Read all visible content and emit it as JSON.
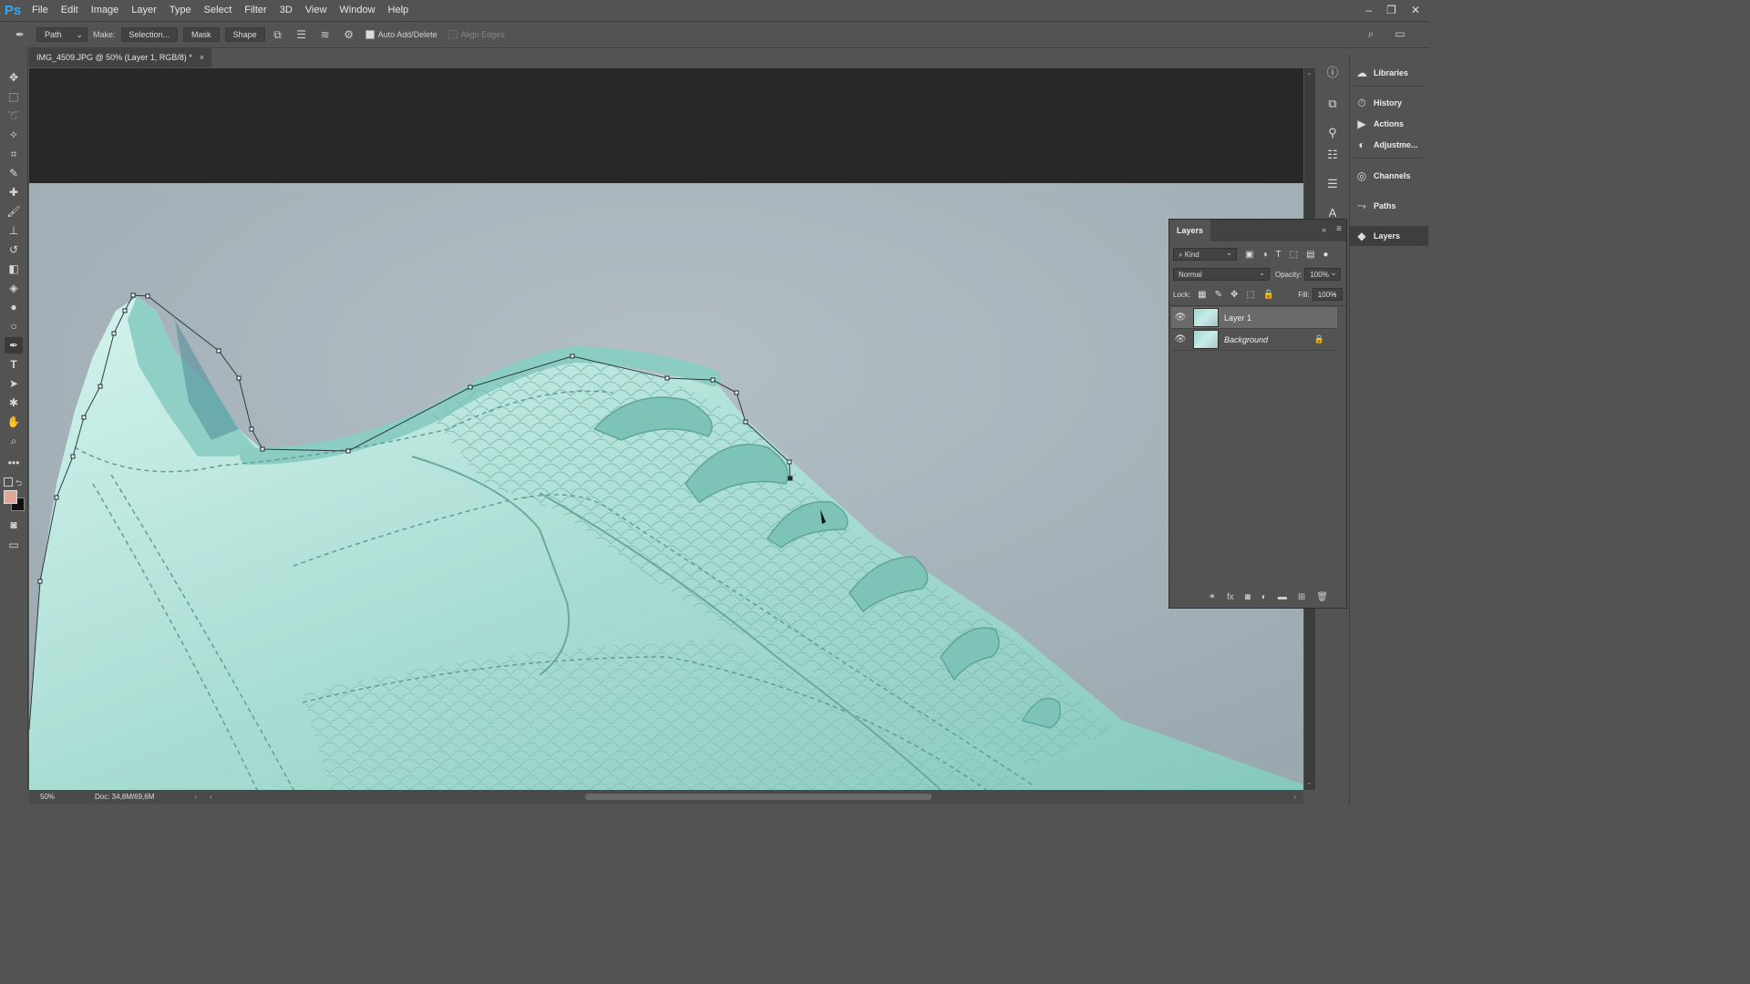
{
  "app": {
    "logo": "Ps"
  },
  "menu": [
    "File",
    "Edit",
    "Image",
    "Layer",
    "Type",
    "Select",
    "Filter",
    "3D",
    "View",
    "Window",
    "Help"
  ],
  "window_controls": {
    "minimize": "–",
    "restore": "❐",
    "close": "✕"
  },
  "options": {
    "tool_mode": "Path",
    "make_label": "Make:",
    "selection_button": "Selection...",
    "mask_button": "Mask",
    "shape_button": "Shape",
    "auto_add_delete": "Auto Add/Delete",
    "align_edges": "Align Edges"
  },
  "document": {
    "tab_title": "IMG_4509.JPG @ 50% (Layer 1, RGB/8) *",
    "close": "×"
  },
  "status": {
    "zoom": "50%",
    "doc_info": "Doc: 34,8M/69,6M"
  },
  "right_panels": [
    "Libraries",
    "History",
    "Actions",
    "Adjustme...",
    "Channels",
    "Paths",
    "Layers"
  ],
  "layers_panel": {
    "title": "Layers",
    "filter_kind": "Kind",
    "blend_mode": "Normal",
    "opacity_label": "Opacity:",
    "opacity_value": "100%",
    "lock_label": "Lock:",
    "fill_label": "Fill:",
    "fill_value": "100%",
    "layers": [
      {
        "name": "Layer 1",
        "visible": true,
        "selected": true
      },
      {
        "name": "Background",
        "visible": true,
        "locked": true
      }
    ]
  },
  "colors": {
    "ui_bg": "#535353",
    "canvas_bg": "#282828",
    "backdrop": "#a9b6bd",
    "shoe_light": "#c5ede5",
    "shoe_mid": "#9fd9cf",
    "shoe_shadow": "#6fb8ad",
    "foreground_swatch": "#e2a494",
    "background_swatch": "#111111",
    "ps_blue": "#31a8ff"
  }
}
